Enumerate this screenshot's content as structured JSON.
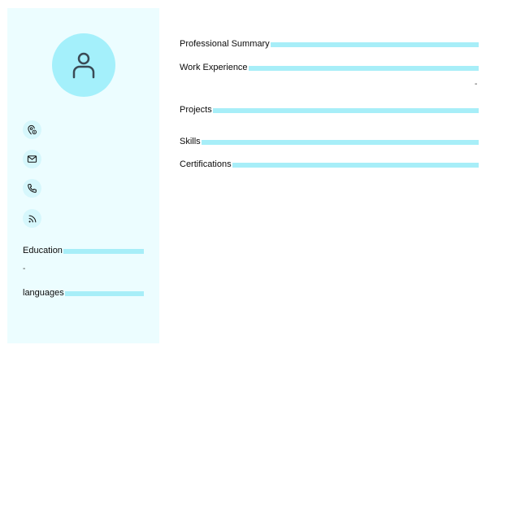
{
  "sidebar": {
    "contact_icons": [
      "location-pin-icon",
      "mail-icon",
      "phone-icon",
      "rss-icon"
    ],
    "sections": {
      "education": {
        "title": "Education",
        "placeholder": "-"
      },
      "languages": {
        "title": "languages"
      }
    }
  },
  "main": {
    "sections": {
      "summary": {
        "title": "Professional Summary"
      },
      "experience": {
        "title": "Work Experience",
        "placeholder": "-"
      },
      "projects": {
        "title": "Projects"
      },
      "skills": {
        "title": "Skills"
      },
      "certifications": {
        "title": "Certifications"
      }
    }
  },
  "colors": {
    "sidebar_bg": "#ecfdff",
    "accent": "#a4f0fb",
    "section_bar": "#a7eef8",
    "icon_stroke": "#3a4a55"
  }
}
